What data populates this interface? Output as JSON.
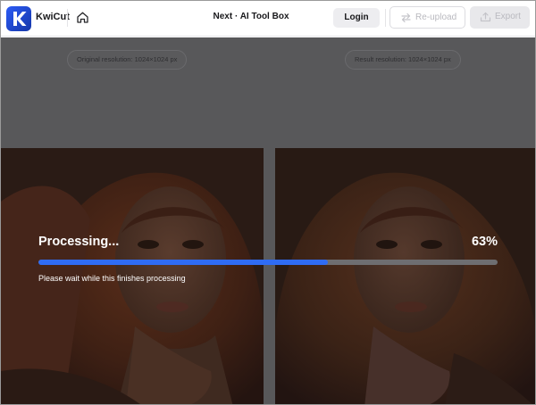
{
  "app": {
    "brand": "KwiCut",
    "page_title": "Next · AI Tool Box"
  },
  "toolbar": {
    "login_label": "Login",
    "reupload_label": "Re-upload",
    "export_label": "Export"
  },
  "workspace": {
    "original_label": "Original resolution: 1024×1024 px",
    "result_label": "Result resolution: 1024×1024 px"
  },
  "processing": {
    "title": "Processing...",
    "percent_label": "63%",
    "progress": 0.63,
    "message": "Please wait while this finishes processing"
  },
  "colors": {
    "accent": "#2f6cf4",
    "overlay": "#58585a"
  }
}
